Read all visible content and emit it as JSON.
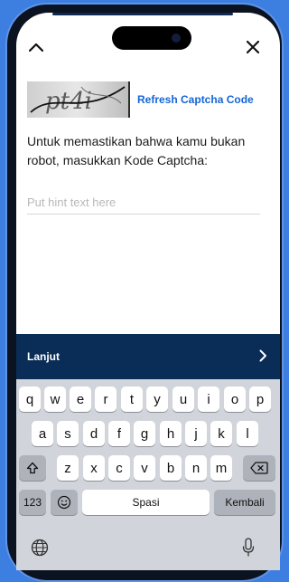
{
  "colors": {
    "accent": "#1565d6",
    "primary_bar": "#0a2d57",
    "background": "#3d7fe0"
  },
  "header": {
    "collapse_icon": "chevron-up-icon",
    "close_icon": "close-icon"
  },
  "captcha": {
    "image_text": "pt4i",
    "refresh_label": "Refresh Captcha Code"
  },
  "form": {
    "prompt": "Untuk memastikan bahwa kamu bukan robot, masukkan Kode Captcha:",
    "placeholder": "Put hint text here",
    "value": ""
  },
  "action": {
    "label": "Lanjut",
    "icon": "chevron-right-icon"
  },
  "keyboard": {
    "row1": [
      "q",
      "w",
      "e",
      "r",
      "t",
      "y",
      "u",
      "i",
      "o",
      "p"
    ],
    "row2": [
      "a",
      "s",
      "d",
      "f",
      "g",
      "h",
      "j",
      "k",
      "l"
    ],
    "row3": [
      "z",
      "x",
      "c",
      "v",
      "b",
      "n",
      "m"
    ],
    "shift_icon": "shift-icon",
    "backspace_icon": "backspace-icon",
    "numbers_label": "123",
    "emoji_icon": "emoji-icon",
    "space_label": "Spasi",
    "return_label": "Kembali",
    "globe_icon": "globe-icon",
    "mic_icon": "microphone-icon"
  }
}
